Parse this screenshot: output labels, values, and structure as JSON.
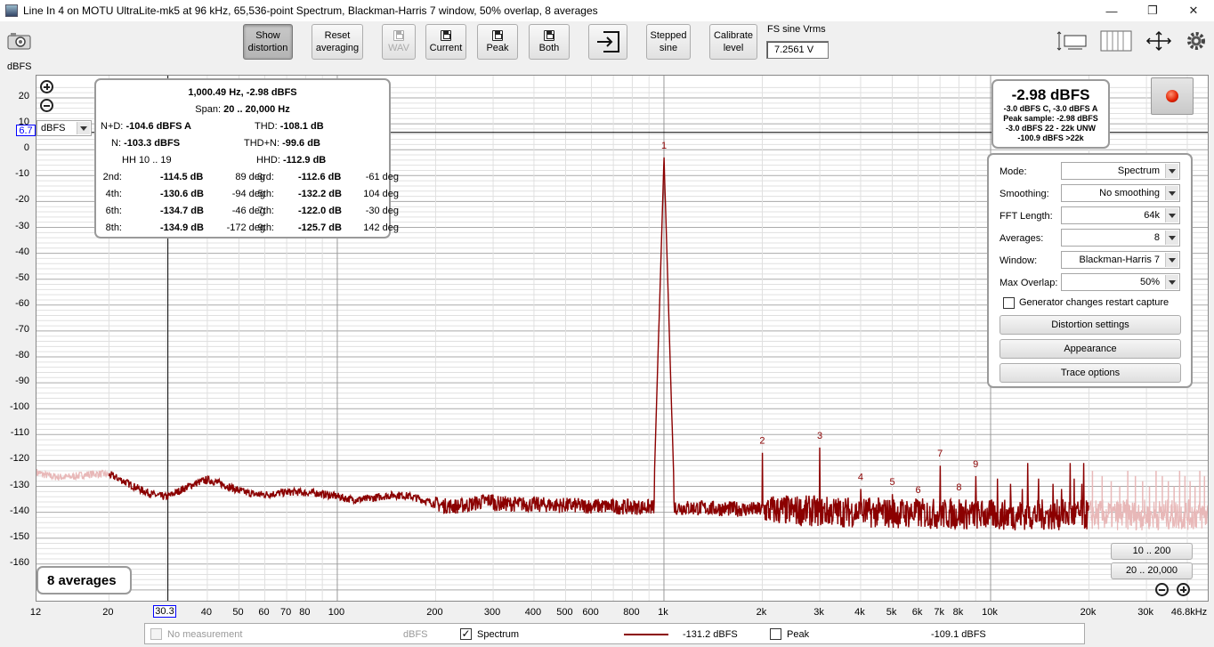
{
  "window": {
    "title": "Line In 4 on MOTU UltraLite-mk5 at 96 kHz, 65,536-point Spectrum, Blackman-Harris 7 window, 50% overlap, 8 averages",
    "minimize": "—",
    "maximize": "❐",
    "close": "✕"
  },
  "toolbar": {
    "show_distortion": [
      "Show",
      "distortion"
    ],
    "reset_averaging": [
      "Reset",
      "averaging"
    ],
    "wav": "WAV",
    "current": "Current",
    "peak": "Peak",
    "both": "Both",
    "stepped_sine": [
      "Stepped",
      "sine"
    ],
    "calibrate_level": [
      "Calibrate",
      "level"
    ],
    "fs_label": "FS sine Vrms",
    "fs_value": "7.2561 V"
  },
  "graph": {
    "y_unit": "dBFS",
    "y_ticks": [
      "20",
      "10",
      "0",
      "-10",
      "-20",
      "-30",
      "-40",
      "-50",
      "-60",
      "-70",
      "-80",
      "-90",
      "-100",
      "-110",
      "-120",
      "-130",
      "-140",
      "-150",
      "-160"
    ],
    "x_ticks": [
      "12",
      "20",
      "30.3",
      "40",
      "50",
      "60",
      "70",
      "80",
      "100",
      "200",
      "300",
      "400",
      "500",
      "600",
      "800",
      "1k",
      "2k",
      "3k",
      "4k",
      "5k",
      "6k",
      "7k",
      "8k",
      "10k",
      "20k",
      "30k",
      "46.8kHz"
    ],
    "cursor_x": "30.3",
    "cursor_y": "6.7",
    "y_unit_select": "dBFS",
    "colors": {
      "trace": "#8b0000",
      "trace_faded": "#e8b8b8",
      "grid_major": "#aaaaaa",
      "grid_minor": "#e0e0e0",
      "harmonic_label": "#8b0000"
    },
    "harmonic_labels": [
      "1",
      "2",
      "3",
      "4",
      "5",
      "6",
      "7",
      "8",
      "9"
    ]
  },
  "chart_data": {
    "type": "line",
    "title": "",
    "xlabel": "",
    "ylabel": "dBFS",
    "x_scale": "log",
    "xlim": [
      12,
      46800
    ],
    "ylim": [
      -170,
      25
    ],
    "grid": true,
    "series": [
      {
        "name": "Spectrum",
        "noise_floor_points": [
          [
            12,
            -124
          ],
          [
            20,
            -127
          ],
          [
            30,
            -133
          ],
          [
            40,
            -129
          ],
          [
            60,
            -132
          ],
          [
            80,
            -134
          ],
          [
            100,
            -133
          ],
          [
            200,
            -136
          ],
          [
            400,
            -137
          ],
          [
            800,
            -138
          ],
          [
            1000,
            -138
          ],
          [
            2000,
            -139
          ],
          [
            4000,
            -140
          ],
          [
            10000,
            -141
          ],
          [
            20000,
            -141
          ],
          [
            46800,
            -141
          ]
        ],
        "peaks": [
          {
            "label": "1",
            "freq": 1000.49,
            "level": -2.98
          },
          {
            "label": "2",
            "freq": 2000,
            "level": -117
          },
          {
            "label": "3",
            "freq": 3000,
            "level": -115
          },
          {
            "label": "4",
            "freq": 4000,
            "level": -131
          },
          {
            "label": "5",
            "freq": 5000,
            "level": -133
          },
          {
            "label": "6",
            "freq": 6000,
            "level": -136
          },
          {
            "label": "7",
            "freq": 7000,
            "level": -122
          },
          {
            "label": "8",
            "freq": 8000,
            "level": -135
          },
          {
            "label": "9",
            "freq": 9000,
            "level": -126
          }
        ],
        "spurs_above_20k": [
          [
            13000,
            -121
          ],
          [
            17500,
            -121
          ],
          [
            19300,
            -121
          ]
        ]
      }
    ]
  },
  "distortion": {
    "header": "1,000.49 Hz, -2.98 dBFS",
    "span_label": "Span:",
    "span_value": "20 .. 20,000 Hz",
    "nd_label": "N+D:",
    "nd_value": "-104.6 dBFS A",
    "thd_label": "THD:",
    "thd_value": "-108.1 dB",
    "n_label": "N:",
    "n_value": "-103.3 dBFS",
    "thdn_label": "THD+N:",
    "thdn_value": "-99.6 dB",
    "hh_label": "HH 10 .. 19",
    "hhd_label": "HHD:",
    "hhd_value": "-112.9 dB",
    "harmonics": [
      {
        "l1": "2nd:",
        "v1": "-114.5 dB",
        "p1": "89 deg",
        "l2": "3rd:",
        "v2": "-112.6 dB",
        "p2": "-61 deg"
      },
      {
        "l1": "4th:",
        "v1": "-130.6 dB",
        "p1": "-94 deg",
        "l2": "5th:",
        "v2": "-132.2 dB",
        "p2": "104 deg"
      },
      {
        "l1": "6th:",
        "v1": "-134.7 dB",
        "p1": "-46 deg",
        "l2": "7th:",
        "v2": "-122.0 dB",
        "p2": "-30 deg"
      },
      {
        "l1": "8th:",
        "v1": "-134.9 dB",
        "p1": "-172 deg",
        "l2": "9th:",
        "v2": "-125.7 dB",
        "p2": "142 deg"
      }
    ]
  },
  "level": {
    "main": "-2.98 dBFS",
    "lines": [
      "-3.0 dBFS C, -3.0 dBFS A",
      "Peak sample: -2.98 dBFS",
      "-3.0 dBFS 22 - 22k UNW",
      "-100.9 dBFS >22k"
    ]
  },
  "settings": {
    "mode_label": "Mode:",
    "mode_value": "Spectrum",
    "smoothing_label": "Smoothing:",
    "smoothing_value": "No  smoothing",
    "fft_label": "FFT Length:",
    "fft_value": "64k",
    "averages_label": "Averages:",
    "averages_value": "8",
    "window_label": "Window:",
    "window_value": "Blackman-Harris 7",
    "overlap_label": "Max Overlap:",
    "overlap_value": "50%",
    "restart_label": "Generator changes restart capture",
    "distortion_settings": "Distortion settings",
    "appearance": "Appearance",
    "trace_options": "Trace options"
  },
  "averages_badge": "8 averages",
  "range_buttons": {
    "r1": "10 .. 200",
    "r2": "20 .. 20,000"
  },
  "legend": {
    "no_measurement": "No measurement",
    "no_measurement_unit": "dBFS",
    "spectrum": "Spectrum",
    "spectrum_value": "-131.2 dBFS",
    "peak": "Peak",
    "peak_value": "-109.1 dBFS",
    "spectrum_check": "✓"
  }
}
